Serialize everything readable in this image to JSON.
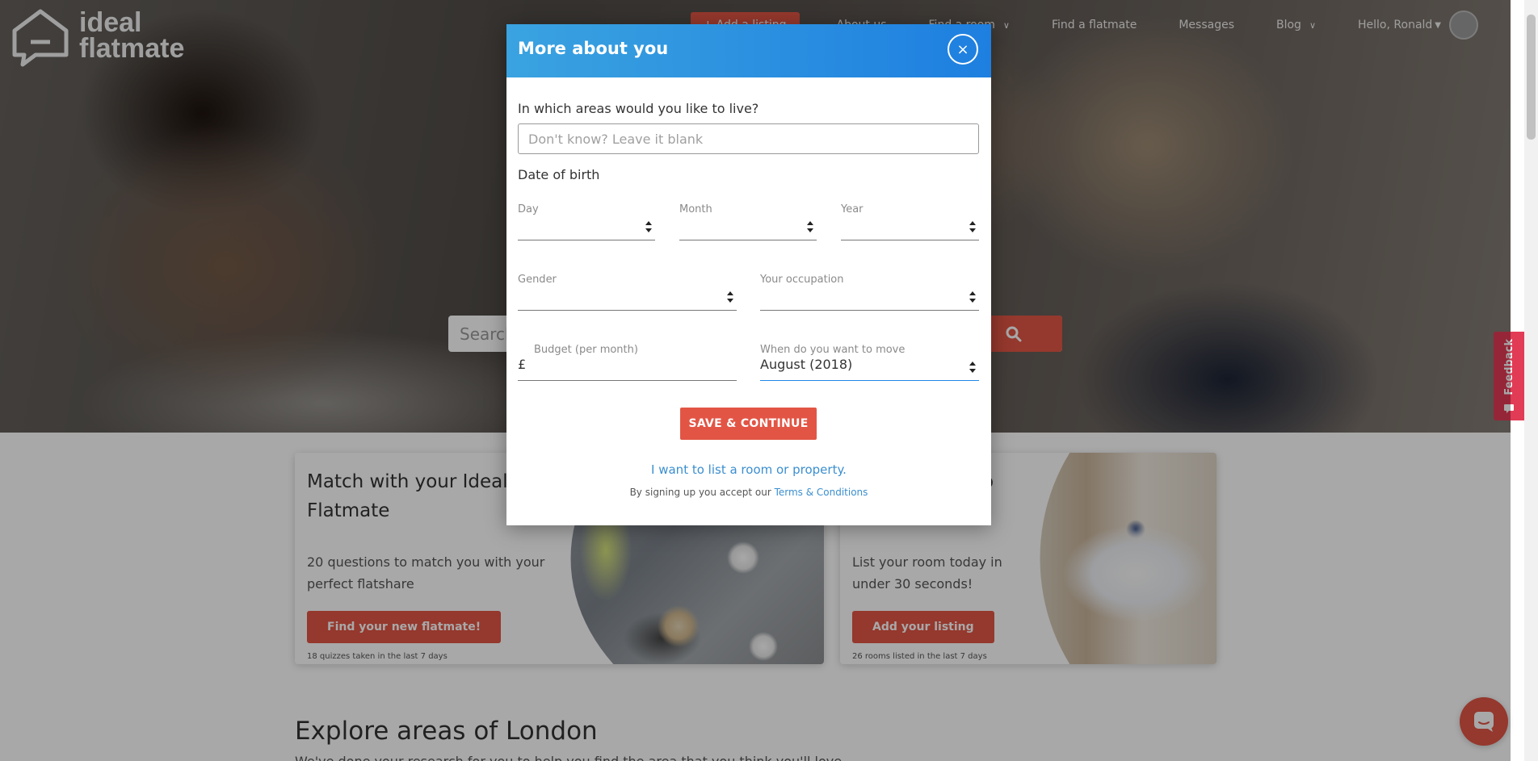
{
  "header": {
    "logo_line1": "ideal",
    "logo_line2": "flatmate",
    "nav": {
      "add_listing": "+ Add a listing",
      "about_us": "About us",
      "find_room": "Find a room",
      "find_flatmate": "Find a flatmate",
      "messages": "Messages",
      "blog": "Blog",
      "user_greeting": "Hello, Ronald"
    }
  },
  "hero": {
    "search_placeholder": "Search"
  },
  "feedback_tab": {
    "label": "Feedback"
  },
  "cards": [
    {
      "title": "Match with your Ideal Flatmate",
      "description": "20 questions to match you with your perfect flatshare",
      "button": "Find your new flatmate!",
      "note": "18 quizzes taken in the last 7 days"
    },
    {
      "title": "o",
      "description": "List your room today in under 30 seconds!",
      "button": "Add your listing",
      "note": "26 rooms listed in the last 7 days"
    }
  ],
  "explore": {
    "title": "Explore areas of London",
    "subtitle": "We've done your research for you to help you find the area that you think you'll love"
  },
  "modal": {
    "title": "More about you",
    "close_symbol": "×",
    "areas_label": "In which areas would you like to live?",
    "areas_placeholder": "Don't know? Leave it blank",
    "dob_label": "Date of birth",
    "day_label": "Day",
    "month_label": "Month",
    "year_label": "Year",
    "gender_label": "Gender",
    "occupation_label": "Your occupation",
    "budget_label": "Budget (per month)",
    "budget_currency": "£",
    "move_label": "When do you want to move",
    "move_value": "August (2018)",
    "save_button": "SAVE & CONTINUE",
    "list_link": "I want to list a room or property.",
    "terms_prefix": "By signing up you accept our ",
    "terms_link": "Terms & Conditions"
  },
  "colors": {
    "accent_red": "#e25545",
    "modal_header_start": "#3aa3e0",
    "modal_header_end": "#1e7fe0",
    "link_blue": "#3b8fcf",
    "feedback_pink": "#e23b55"
  }
}
